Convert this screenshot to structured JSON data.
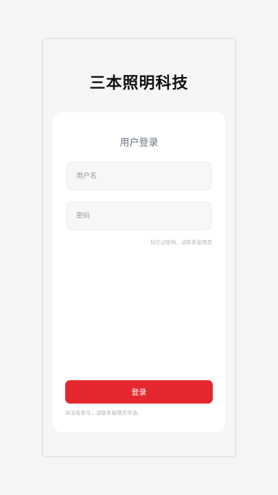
{
  "app": {
    "brand": "三本照明科技"
  },
  "login": {
    "title": "用户登录",
    "username_placeholder": "用户名",
    "password_placeholder": "密码",
    "forgot_hint": "如忘记密码，请联系管理员",
    "submit_label": "登录",
    "no_account_note": "如没有账号，请联系管理员申请。"
  },
  "colors": {
    "accent": "#e5282f",
    "card": "#ffffff",
    "background": "#f6f6f6"
  }
}
